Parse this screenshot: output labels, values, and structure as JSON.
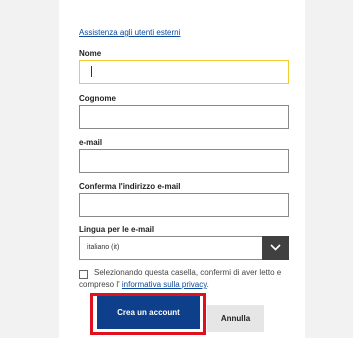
{
  "form": {
    "help_link": "Assistenza agli utenti esterni",
    "fields": {
      "first_name": {
        "label": "Nome",
        "value": ""
      },
      "last_name": {
        "label": "Cognome",
        "value": ""
      },
      "email": {
        "label": "e-mail",
        "value": ""
      },
      "email_confirm": {
        "label": "Conferma l'indirizzo e-mail",
        "value": ""
      }
    },
    "language": {
      "label": "Lingua per le e-mail",
      "selected": "italiano (it)"
    },
    "consent": {
      "checked": false,
      "text": "Selezionando questa casella, confermi di aver letto e compreso l'",
      "link": "informativa sulla privacy",
      "suffix": "."
    },
    "buttons": {
      "create": "Crea un account",
      "cancel": "Annulla"
    },
    "colors": {
      "primary": "#0d3f8a",
      "focus_border": "#f2cb2c",
      "highlight": "#e0101e",
      "link": "#0b4a9e"
    }
  }
}
